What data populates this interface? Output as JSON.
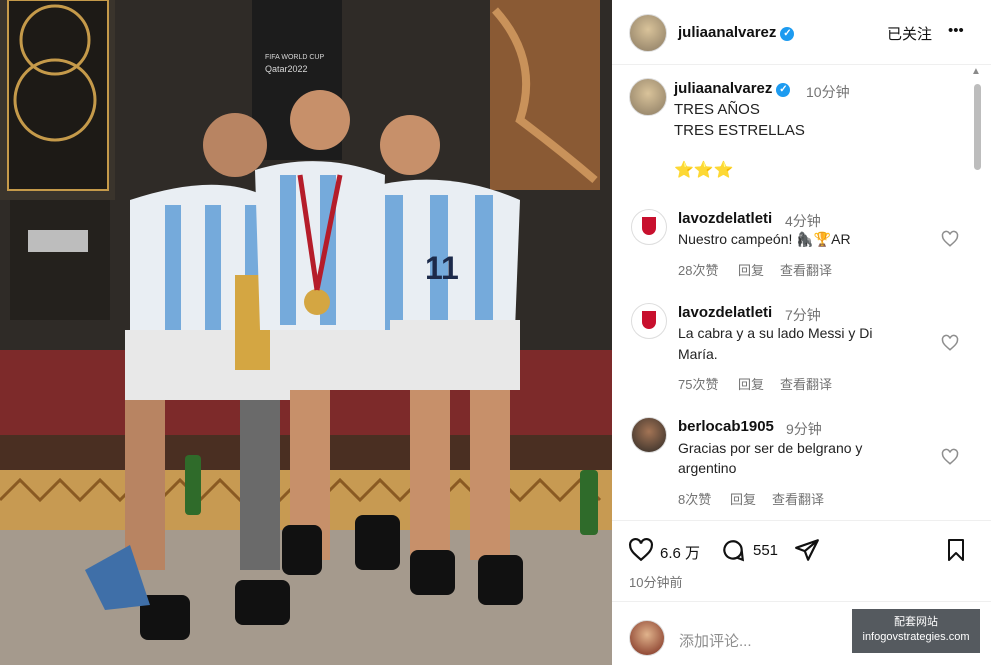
{
  "post": {
    "author": "juliaanalvarez",
    "follow_state": "已关注",
    "more": "•••",
    "caption_author": "juliaanalvarez",
    "caption_time": "10分钟",
    "caption_line1": "TRES AÑOS",
    "caption_line2": "TRES ESTRELLAS",
    "caption_stars": "⭐⭐⭐"
  },
  "photo": {
    "banner_line1": "FIFA WORLD CUP",
    "banner_line2": "Qatar2022",
    "jersey_number": "11"
  },
  "comments": [
    {
      "user": "lavozdelatleti",
      "time": "4分钟",
      "text": "Nuestro campeón! 🦍🏆AR",
      "likes": "28次赞",
      "reply": "回复",
      "translate": "查看翻译"
    },
    {
      "user": "lavozdelatleti",
      "time": "7分钟",
      "text_line1": "La cabra y a su lado Messi y Di",
      "text_line2": "María.",
      "likes": "75次赞",
      "reply": "回复",
      "translate": "查看翻译"
    },
    {
      "user": "berlocab1905",
      "time": "9分钟",
      "text_line1": "Gracias por ser de belgrano y",
      "text_line2": "argentino",
      "likes": "8次赞",
      "reply": "回复",
      "translate": "查看翻译"
    }
  ],
  "actions": {
    "likes_count": "6.6 万",
    "comments_count": "551",
    "posted": "10分钟前",
    "comment_placeholder": "添加评论..."
  },
  "watermark": {
    "line1": "配套网站",
    "line2": "infogovstrategies.com"
  },
  "colors": {
    "verified": "#1d9bf0",
    "muted": "#737373",
    "red_accent": "#c8102e"
  }
}
